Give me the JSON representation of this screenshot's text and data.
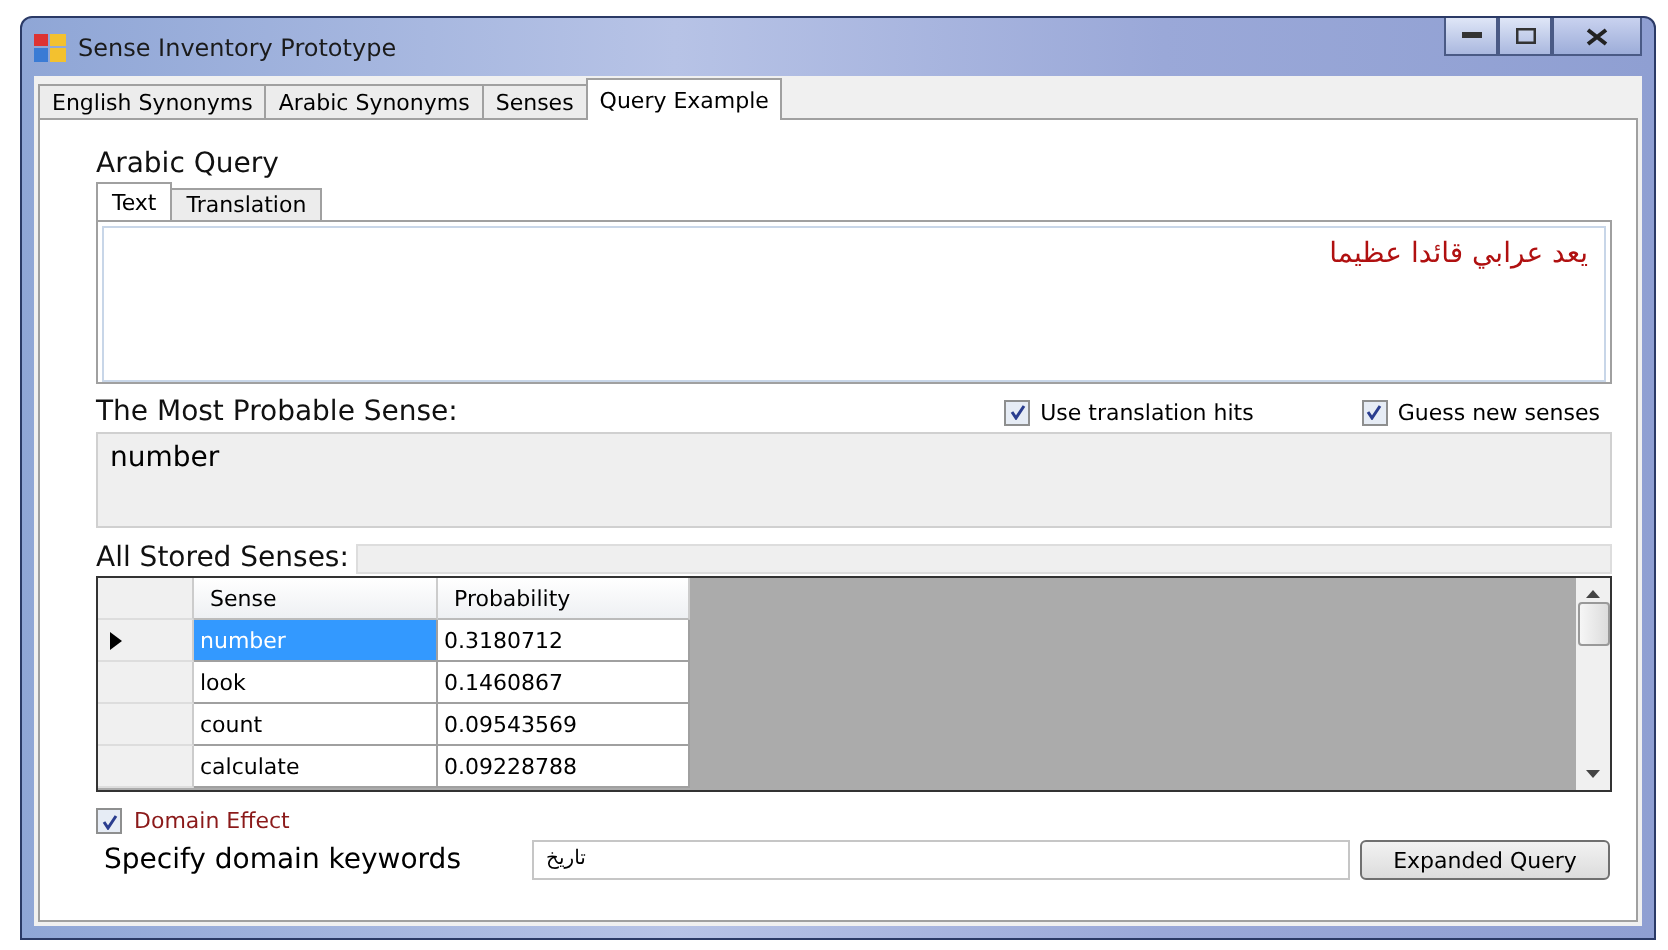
{
  "window": {
    "title": "Sense Inventory Prototype"
  },
  "tabs": [
    {
      "label": "English Synonyms",
      "selected": false
    },
    {
      "label": "Arabic Synonyms",
      "selected": false
    },
    {
      "label": "Senses",
      "selected": false
    },
    {
      "label": "Query Example",
      "selected": true
    }
  ],
  "query": {
    "title": "Arabic Query",
    "tabs": [
      {
        "label": "Text",
        "selected": true
      },
      {
        "label": "Translation",
        "selected": false
      }
    ],
    "value": "يعد عرابي قائدا عظيما"
  },
  "most_probable": {
    "title": "The Most Probable Sense:",
    "value": "number"
  },
  "options": [
    {
      "label": "Use translation hits",
      "checked": true
    },
    {
      "label": "Guess new senses",
      "checked": true
    }
  ],
  "stored": {
    "title": "All Stored Senses:",
    "columns": [
      "Sense",
      "Probability"
    ],
    "rows": [
      {
        "sense": "number",
        "probability": "0.3180712",
        "selected": true
      },
      {
        "sense": "look",
        "probability": "0.1460867",
        "selected": false
      },
      {
        "sense": "count",
        "probability": "0.09543569",
        "selected": false
      },
      {
        "sense": "calculate",
        "probability": "0.09228788",
        "selected": false
      }
    ]
  },
  "domain_effect": {
    "label": "Domain Effect",
    "checked": true
  },
  "keywords": {
    "label": "Specify domain keywords",
    "value": "تاريخ"
  },
  "button": "Expanded Query"
}
